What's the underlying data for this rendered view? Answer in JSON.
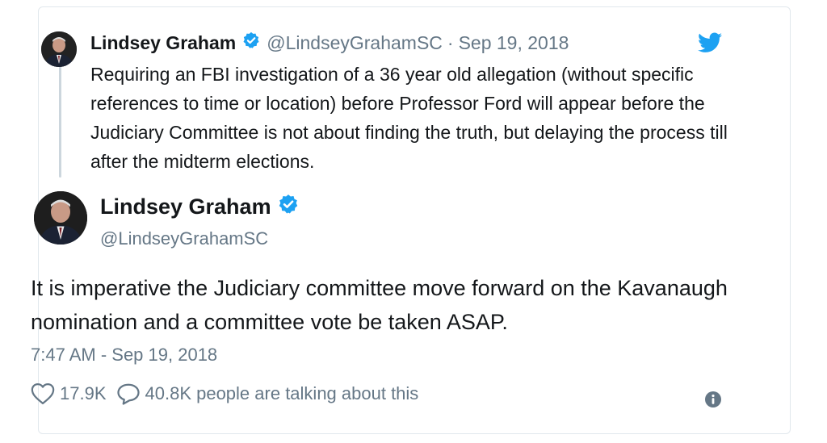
{
  "parent_tweet": {
    "name": "Lindsey Graham",
    "handle": "@LindseyGrahamSC",
    "separator": "·",
    "date": "Sep 19, 2018",
    "text": "Requiring an FBI investigation of a 36 year old allegation (without specific references to time or location) before Professor Ford will appear before the Judiciary Committee is not about finding the truth, but delaying the process till after the midterm elections."
  },
  "main_tweet": {
    "name": "Lindsey Graham",
    "handle": "@LindseyGrahamSC",
    "text": "It is imperative the Judiciary committee move forward on the Kavanaugh nomination and a committee vote be taken ASAP.",
    "timestamp": "7:47 AM - Sep 19, 2018"
  },
  "actions": {
    "likes": "17.9K",
    "talking": "40.8K people are talking about this"
  },
  "colors": {
    "verified": "#1da1f2",
    "twitter_brand": "#1da1f2",
    "secondary_text": "#657786",
    "border": "#e1e8ed"
  },
  "icons": [
    "twitter-bird-icon",
    "verified-badge-icon",
    "heart-icon",
    "speech-bubble-icon",
    "info-icon"
  ]
}
